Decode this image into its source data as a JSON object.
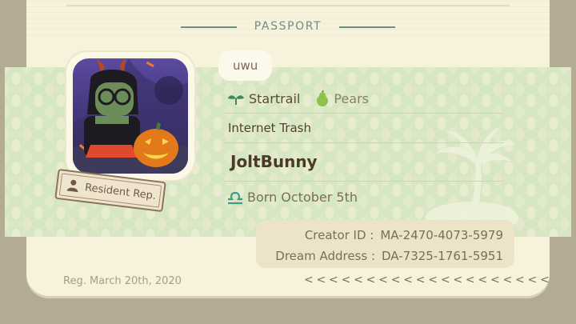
{
  "header": {
    "title": "PASSPORT"
  },
  "profile": {
    "comment": "uwu",
    "fruit_icon": "fruit-icon",
    "island_icon": "sprout-icon",
    "island": "Startrail",
    "fruit": "Pears",
    "title": "Internet Trash",
    "name": "JoltBunny",
    "birthday_icon": "libra-icon",
    "birthday": "Born October 5th",
    "resident_badge": "Resident Rep."
  },
  "codes": {
    "creator_label": "Creator ID :",
    "creator_id": "MA-2470-4073-5979",
    "dream_label": "Dream Address :",
    "dream_address": "DA-7325-1761-5951"
  },
  "footer": {
    "registered": "Reg. March 20th, 2020",
    "arrows": "<<<<<<<<<<<<<<<<<<<<"
  },
  "colors": {
    "accent": "#6b8f86",
    "band": "#d8e7c3",
    "card": "#f6f2dc"
  }
}
